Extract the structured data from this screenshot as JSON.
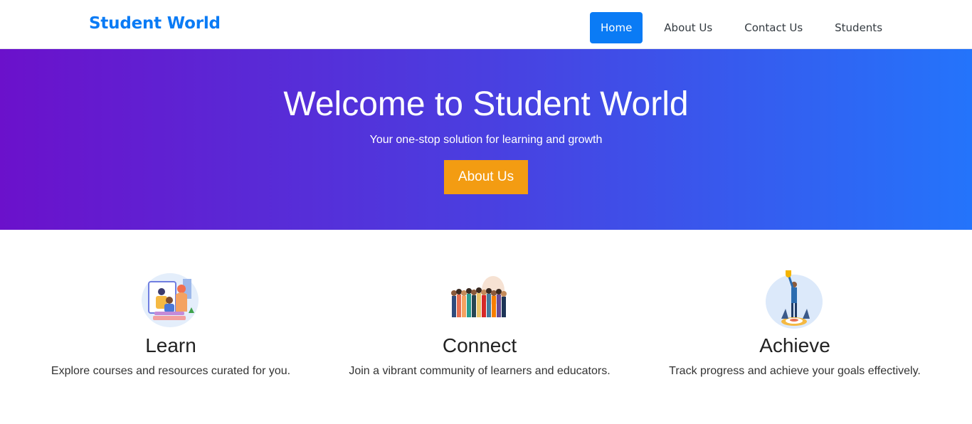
{
  "navbar": {
    "brand": "Student World",
    "links": [
      {
        "label": "Home",
        "active": true
      },
      {
        "label": "About Us",
        "active": false
      },
      {
        "label": "Contact Us",
        "active": false
      },
      {
        "label": "Students",
        "active": false
      }
    ],
    "accent_color": "#0a7bf5"
  },
  "hero": {
    "title": "Welcome to Student World",
    "subtitle": "Your one-stop solution for learning and growth",
    "button_label": "About Us",
    "button_color": "#f39c12",
    "gradient": [
      "#6b11cb",
      "#2474fb"
    ]
  },
  "features": [
    {
      "icon": "learning-illustration-icon",
      "title": "Learn",
      "description": "Explore courses and resources curated for you."
    },
    {
      "icon": "community-people-illustration-icon",
      "title": "Connect",
      "description": "Join a vibrant community of learners and educators."
    },
    {
      "icon": "achievement-target-illustration-icon",
      "title": "Achieve",
      "description": "Track progress and achieve your goals effectively."
    }
  ]
}
